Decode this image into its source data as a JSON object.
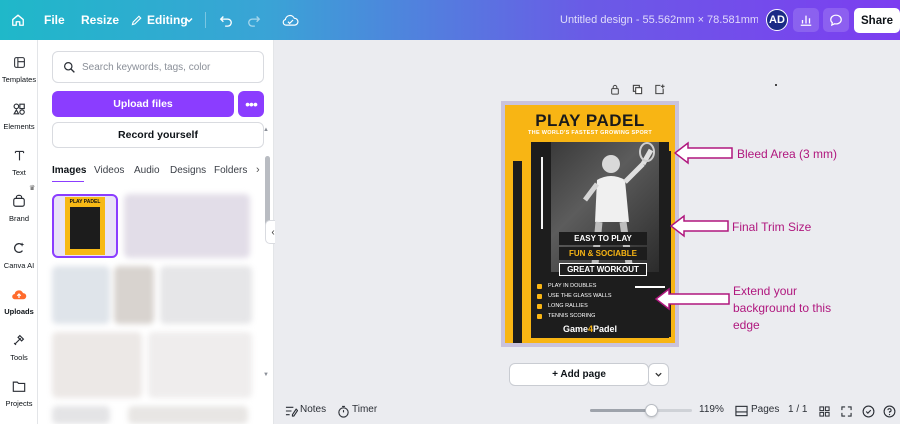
{
  "topbar": {
    "file_label": "File",
    "resize_label": "Resize",
    "editing_label": "Editing",
    "title": "Untitled design - 55.562mm × 78.581mm",
    "avatar_initials": "AD",
    "share_label": "Share"
  },
  "rail": {
    "items": [
      {
        "label": "Templates",
        "icon": "templates-icon"
      },
      {
        "label": "Elements",
        "icon": "elements-icon"
      },
      {
        "label": "Text",
        "icon": "text-icon"
      },
      {
        "label": "Brand",
        "icon": "brand-icon"
      },
      {
        "label": "Canva AI",
        "icon": "canva-ai-icon"
      },
      {
        "label": "Uploads",
        "icon": "uploads-icon"
      },
      {
        "label": "Tools",
        "icon": "tools-icon"
      },
      {
        "label": "Projects",
        "icon": "projects-icon"
      }
    ]
  },
  "panel": {
    "search_placeholder": "Search keywords, tags, color",
    "upload_label": "Upload files",
    "more_label": "•••",
    "record_label": "Record yourself",
    "tabs": [
      "Images",
      "Videos",
      "Audio",
      "Designs",
      "Folders"
    ]
  },
  "poster": {
    "mini_title": "PLAY PADEL",
    "title": "PLAY PADEL",
    "subtitle": "THE WORLD'S FASTEST GROWING SPORT",
    "pills": [
      "EASY TO PLAY",
      "FUN & SOCIABLE",
      "GREAT WORKOUT"
    ],
    "list": [
      "PLAY IN DOUBLES",
      "USE THE GLASS WALLS",
      "LONG RALLIES",
      "TENNIS SCORING"
    ],
    "brand_pre": "Game",
    "brand_mid": "4",
    "brand_post": "Padel"
  },
  "annotations": {
    "bleed": "Bleed Area (3 mm)",
    "trim": "Final Trim Size",
    "extend_line1": "Extend your",
    "extend_line2": "background to this",
    "extend_line3": "edge"
  },
  "canvas": {
    "add_page_label": "+ Add page"
  },
  "bottombar": {
    "notes_label": "Notes",
    "timer_label": "Timer",
    "zoom_value": "119%",
    "zoom_fraction": 0.6,
    "pages_label": "Pages",
    "page_count": "1 / 1"
  },
  "colors": {
    "accent": "#8b3dff",
    "poster_yellow": "#f8b514",
    "annotation": "#b0177e"
  }
}
